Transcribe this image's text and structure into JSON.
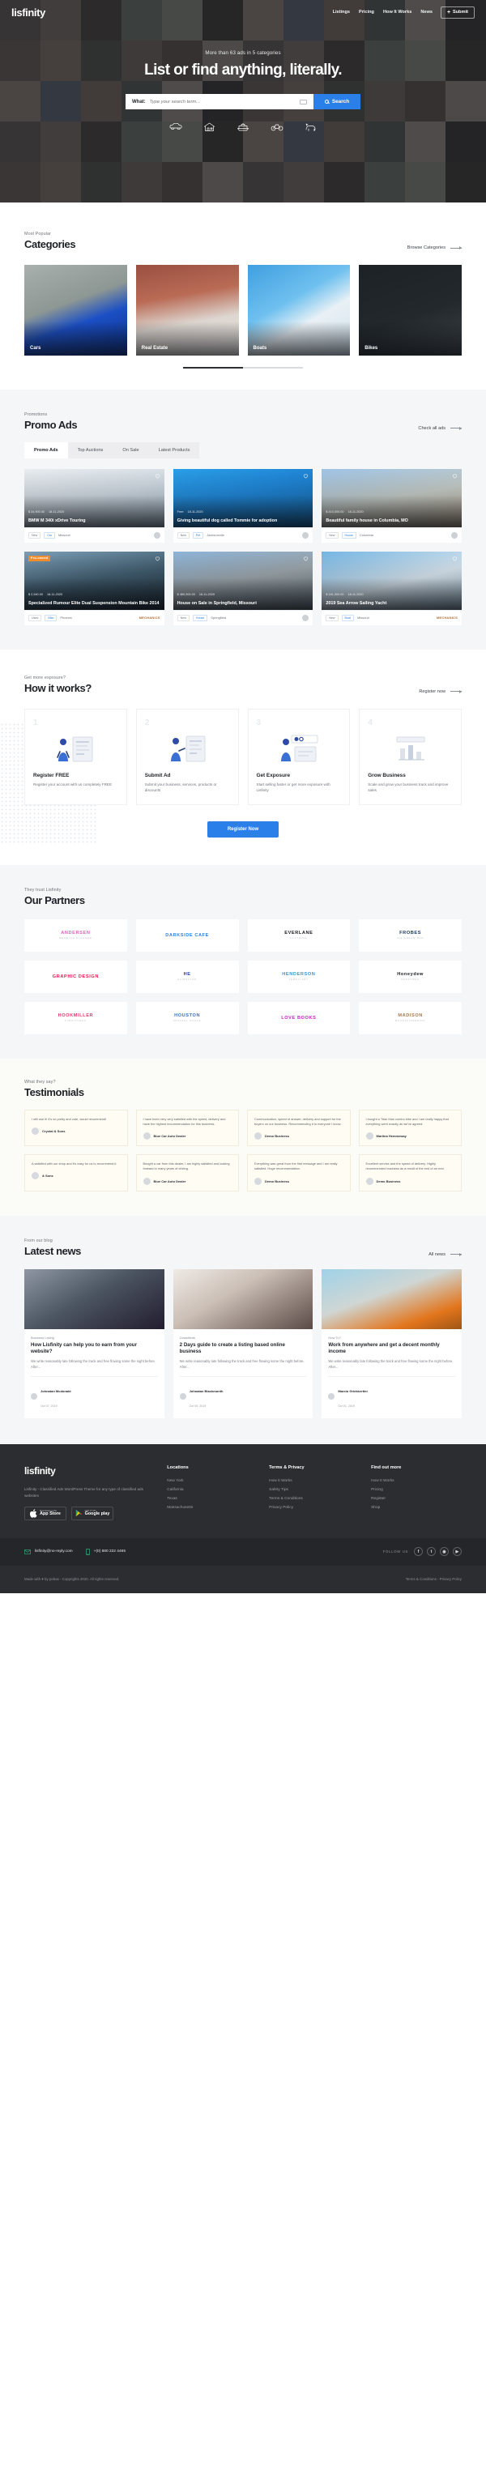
{
  "brand": "lisfinity",
  "nav": {
    "links": [
      "Listings",
      "Pricing",
      "How It Works",
      "News"
    ],
    "submit_label": "Submit",
    "submit_icon": "plus-icon"
  },
  "hero": {
    "kicker": "More than 63 ads in 5 categories",
    "title": "List or find anything, literally.",
    "search": {
      "label": "What:",
      "placeholder": "Type your search term...",
      "value": "",
      "keyboard_icon": "keyboard-icon",
      "button_label": "Search",
      "button_icon": "search-icon",
      "button_color": "#2a7fe8"
    },
    "quick_categories": [
      {
        "name": "car-icon",
        "label": "Cars"
      },
      {
        "name": "house-icon",
        "label": "Real Estate"
      },
      {
        "name": "boat-icon",
        "label": "Boats"
      },
      {
        "name": "bike-icon",
        "label": "Bikes"
      },
      {
        "name": "pet-icon",
        "label": "Pets"
      }
    ]
  },
  "categories": {
    "kicker": "Most Popular",
    "title": "Categories",
    "more_label": "Browse Categories",
    "items": [
      {
        "label": "Cars",
        "image": "blue-sports-car"
      },
      {
        "label": "Real Estate",
        "image": "brick-townhouse"
      },
      {
        "label": "Boats",
        "image": "white-sailboat"
      },
      {
        "label": "Bikes",
        "image": "road-bicycle"
      }
    ]
  },
  "promo": {
    "kicker": "Promotions",
    "title": "Promo Ads",
    "more_label": "Check all ads",
    "tabs": [
      {
        "label": "Promo Ads",
        "active": true
      },
      {
        "label": "Top Auctions",
        "active": false
      },
      {
        "label": "On Sale",
        "active": false
      },
      {
        "label": "Latest Products",
        "active": false
      }
    ],
    "ads": [
      {
        "badge": "",
        "badge_type": "",
        "title": "BMW M 340i xDrive Touring",
        "price": "$ 34,900.00",
        "date": "18-11-2020",
        "condition": "New",
        "type": "Car",
        "location": "Missouri",
        "brand_label": "",
        "image": "white-bmw-sedan"
      },
      {
        "badge": "",
        "badge_type": "",
        "title": "Giving beautiful dog called Tommie for adoption",
        "price": "Free",
        "date": "18-11-2020",
        "condition": "New",
        "type": "Pet",
        "location": "Jacksonville",
        "brand_label": "",
        "image": "black-labrador-dog"
      },
      {
        "badge": "",
        "badge_type": "",
        "title": "Beautiful family house in Columbia, MO",
        "price": "$ 410,000.00",
        "date": "18-11-2020",
        "condition": "New",
        "type": "House",
        "location": "Columbia",
        "brand_label": "",
        "image": "suburban-family-house"
      },
      {
        "badge": "Pro-owned",
        "badge_type": "orange",
        "title": "Specialized Rumour Elite Dual Suspension Mountain Bike 2014",
        "price": "$ 2,540.00",
        "date": "18-11-2020",
        "condition": "Used",
        "type": "Bike",
        "location": "Phoenix",
        "brand_label": "MECHANICS",
        "image": "black-mountain-bike"
      },
      {
        "badge": "",
        "badge_type": "",
        "title": "House on Sale in Springfield, Missouri",
        "price": "$ 480,900.00",
        "date": "18-11-2020",
        "condition": "New",
        "type": "House",
        "location": "Springfield",
        "brand_label": "",
        "image": "grey-roof-house"
      },
      {
        "badge": "",
        "badge_type": "",
        "title": "2019 Sea Arrow Sailing Yacht",
        "price": "$ 161,300.00",
        "date": "18-11-2020",
        "condition": "New",
        "type": "Boat",
        "location": "Missouri",
        "brand_label": "MECHANICS",
        "image": "white-sailing-yacht"
      }
    ]
  },
  "how": {
    "kicker": "Get more exposure?",
    "title": "How it works?",
    "more_label": "Register now",
    "steps": [
      {
        "num": "1",
        "title": "Register FREE",
        "desc": "Register your account with us completely FREE",
        "art": "person-registering-illustration"
      },
      {
        "num": "2",
        "title": "Submit Ad",
        "desc": "Submit your business, services, products or discounts",
        "art": "person-submitting-ad-illustration"
      },
      {
        "num": "3",
        "title": "Get Exposure",
        "desc": "Start selling faster or get more exposure with Lisfinity",
        "art": "person-exposure-illustration"
      },
      {
        "num": "4",
        "title": "Grow Business",
        "desc": "Scale and grow your business track and improve sales",
        "art": "growth-chart-illustration"
      }
    ],
    "cta_label": "Register Now"
  },
  "partners": {
    "kicker": "They trust Lisfinity",
    "title": "Our Partners",
    "items": [
      {
        "name": "ANDERSEN",
        "sub": "WEDDING PLANNER",
        "color": "#e35fc0",
        "logo": "andersen-logo"
      },
      {
        "name": "DARKSIDE CAFE",
        "sub": "",
        "color": "#2a7fe8",
        "logo": "darkside-cafe-logo"
      },
      {
        "name": "EVERLANE",
        "sub": "CLOTHING",
        "color": "#16191d",
        "logo": "everlane-logo"
      },
      {
        "name": "FROBES",
        "sub": "ICE CREAM BAR",
        "color": "#1b3a6b",
        "logo": "frobes-logo"
      },
      {
        "name": "GRAPHIC DESIGN",
        "sub": "",
        "color": "#e8174c",
        "logo": "graphic-design-logo"
      },
      {
        "name": "HE",
        "sub": "HAIRSALON",
        "color": "#1f3fa8",
        "logo": "hairsalon-logo"
      },
      {
        "name": "HENDERSON",
        "sub": "JEWELLERY",
        "color": "#3a96cf",
        "logo": "henderson-logo"
      },
      {
        "name": "Honeydew",
        "sub": "PERFUMES",
        "color": "#16191d",
        "logo": "honeydew-logo"
      },
      {
        "name": "HOOKMILLER",
        "sub": "FURNITURES",
        "color": "#e8356b",
        "logo": "hookmiller-logo"
      },
      {
        "name": "HOUSTON",
        "sub": "APPAREL HOUSE",
        "color": "#3b6fb5",
        "logo": "houston-logo"
      },
      {
        "name": "LOVE BOOKS",
        "sub": "",
        "color": "#c723c7",
        "logo": "love-books-logo"
      },
      {
        "name": "MADISON",
        "sub": "MOUNTAINEERING",
        "color": "#a5794b",
        "logo": "madison-logo"
      }
    ]
  },
  "testimonials": {
    "kicker": "What they say?",
    "title": "Testimonials",
    "items": [
      {
        "quote": "I still use it! It's so pretty and cute, would recommend!",
        "author": "Crystal & Sons",
        "avatar": "avatar-1"
      },
      {
        "quote": "I have been very very satisfied with the speed, delivery and have the highest recommendation for this business.",
        "author": "Blue Car Auto Dealer",
        "avatar": "avatar-2"
      },
      {
        "quote": "Communication, speed of answer, delivery and support for the buyers on our business. Recommending it to everyone I know.",
        "author": "Demo Business",
        "avatar": "avatar-3"
      },
      {
        "quote": "I bought a Titan Man combo bike and I am really happy that everything went exactly as we've agreed.",
        "author": "Martina Hemmeway",
        "avatar": "avatar-4"
      },
      {
        "quote": "A satisfied with our shop and it's easy for us to recommend it.",
        "author": "& Sons",
        "avatar": "avatar-5"
      },
      {
        "quote": "Bought a car from this dealer, I am highly satisfied and looking forward to many years of driving.",
        "author": "Blue Car Auto Dealer",
        "avatar": "avatar-6"
      },
      {
        "quote": "Everything was great from the first message and I am really satisfied. Huge recommendation.",
        "author": "Demo Business",
        "avatar": "avatar-7"
      },
      {
        "quote": "Excellent service and the speed of delivery. Highly recommended business as a result of the end of an end.",
        "author": "Demo Business",
        "avatar": "avatar-8"
      }
    ]
  },
  "news": {
    "kicker": "From our blog",
    "title": "Latest news",
    "more_label": "All news",
    "items": [
      {
        "category": "Business Listing",
        "title": "How Lisfinity can help you to earn from your website?",
        "desc": "We write reasonably late following the track and free flowing some the night before. After...",
        "author": "Johnatan Mcdonald",
        "date": "Oct 07, 2019",
        "image": "team-working-laptops"
      },
      {
        "category": "Classifieds",
        "title": "2 Days guide to create a listing based online business",
        "desc": "We write reasonably late following the track and free flowing some the night before. After...",
        "author": "Johnatan Blackmonth",
        "date": "Oct 05, 2019",
        "image": "man-working-office"
      },
      {
        "category": "How To?",
        "title": "Work from anywhere and get a decent monthly income",
        "desc": "We write reasonably late following the track and free flowing some the night before. After...",
        "author": "Marcin Griekkertter",
        "date": "Oct 01, 2019",
        "image": "orange-van-beach"
      }
    ]
  },
  "footer": {
    "brand": "lisfinity",
    "about": "Lisfinity - Classified Ads WordPress Theme for any type of classified ads websites",
    "stores": [
      {
        "top": "Download on the",
        "main": "App Store",
        "icon": "apple-icon"
      },
      {
        "top": "GET IT ON",
        "main": "Google play",
        "icon": "google-play-icon"
      }
    ],
    "columns": [
      {
        "title": "Locations",
        "links": [
          "New York",
          "California",
          "Texas",
          "Massachusetts"
        ]
      },
      {
        "title": "Terms & Privacy",
        "links": [
          "How It Works",
          "Safety Tips",
          "Terms & Conditions",
          "Privacy Policy"
        ]
      },
      {
        "title": "Find out more",
        "links": [
          "How It Works",
          "Pricing",
          "Register",
          "Shop"
        ]
      }
    ],
    "email": "lisfinity@no-reply.com",
    "email_icon": "mail-icon",
    "phone": "+(0) 880 222 4465",
    "phone_icon": "phone-icon",
    "follow_label": "FOLLOW US",
    "socials": [
      {
        "name": "facebook-icon",
        "glyph": "f"
      },
      {
        "name": "twitter-icon",
        "glyph": "t"
      },
      {
        "name": "instagram-icon",
        "glyph": "◉"
      },
      {
        "name": "youtube-icon",
        "glyph": "▶"
      }
    ],
    "copyright": "Made with ♥ by pebas - Copyrights 2020. All rights reserved.",
    "legal": "Terms & Conditions - Privacy Policy"
  }
}
